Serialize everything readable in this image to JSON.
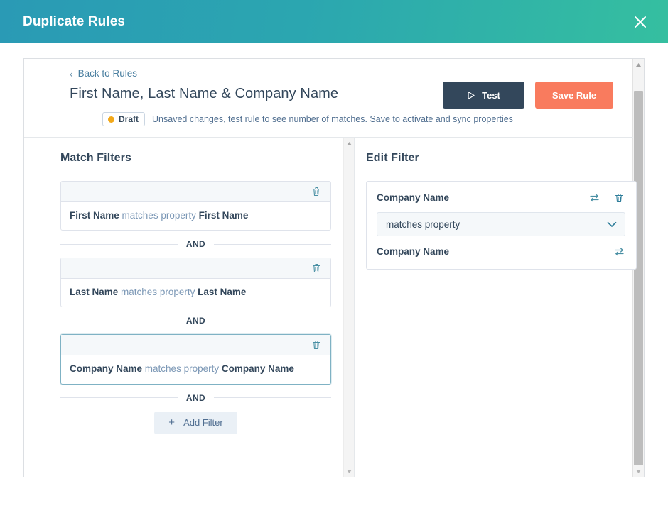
{
  "header": {
    "title": "Duplicate Rules",
    "close_icon": "close-icon"
  },
  "panel": {
    "back_link": "Back to Rules",
    "back_chevron": "‹",
    "rule_title": "First Name, Last Name & Company Name",
    "status": {
      "badge_label": "Draft",
      "badge_dot_color": "#f2a819",
      "note": "Unsaved changes, test rule to see number of matches. Save to activate and sync properties"
    },
    "buttons": {
      "test_label": "Test",
      "test_icon": "play-icon",
      "test_color": "#33475b",
      "save_label": "Save Rule",
      "save_color": "#f97b5e"
    }
  },
  "match_filters": {
    "section_title": "Match Filters",
    "and_label": "AND",
    "add_filter_label": "Add Filter",
    "add_filter_icon": "plus-icon",
    "trash_icon": "trash-icon",
    "items": [
      {
        "property": "First Name",
        "operator": "matches property",
        "value": "First Name",
        "selected": false
      },
      {
        "property": "Last Name",
        "operator": "matches property",
        "value": "Last Name",
        "selected": false
      },
      {
        "property": "Company Name",
        "operator": "matches property",
        "value": "Company Name",
        "selected": true
      }
    ]
  },
  "edit_filter": {
    "section_title": "Edit Filter",
    "property_name": "Company Name",
    "operator_value": "matches property",
    "operator_options": [
      "matches property"
    ],
    "target_property": "Company Name",
    "swap_icon": "swap-icon",
    "trash_icon": "trash-icon",
    "chevron_icon": "chevron-down-icon"
  }
}
